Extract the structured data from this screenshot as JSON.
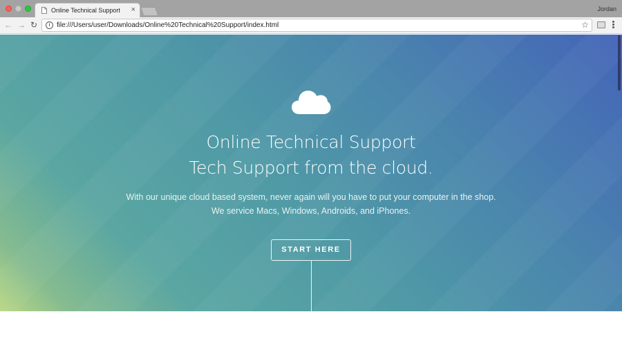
{
  "browser": {
    "tab_title": "Online Technical Support",
    "tab_close": "×",
    "profile_name": "Jordan",
    "url": "file:///Users/user/Downloads/Online%20Technical%20Support/index.html",
    "info_glyph": "i",
    "star_glyph": "☆",
    "back_glyph": "←",
    "forward_glyph": "→",
    "reload_glyph": "↻"
  },
  "hero": {
    "icon": "cloud-icon",
    "title_line1": "Online Technical Support",
    "title_line2": "Tech Support from the cloud.",
    "description_line1": "With our unique cloud based system, never again will you have to put your computer in the shop.",
    "description_line2": "We service Macs, Windows, Androids, and iPhones.",
    "cta_label": "START HERE"
  },
  "colors": {
    "gradient_top_right": "#4464b8",
    "gradient_middle": "#509aa6",
    "gradient_bottom_left": "#b9d784",
    "text": "#ffffff"
  }
}
